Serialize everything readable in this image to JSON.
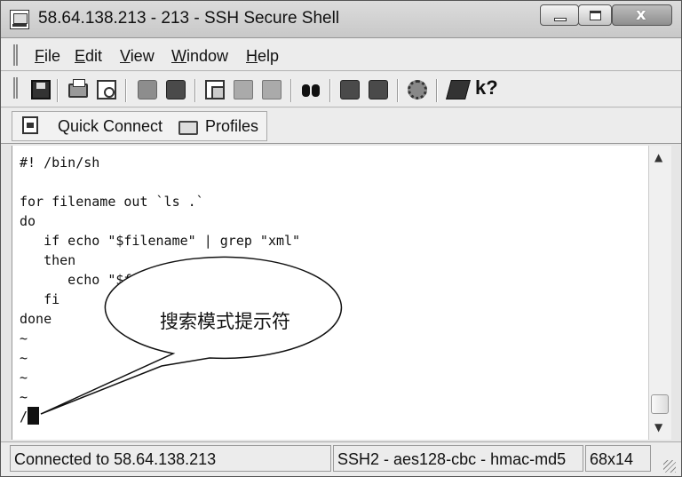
{
  "window": {
    "title": "58.64.138.213 - 213 - SSH Secure Shell",
    "close_glyph": "x"
  },
  "menu": {
    "items": [
      "File",
      "Edit",
      "View",
      "Window",
      "Help"
    ]
  },
  "toolbar": {
    "help_glyph": "k?"
  },
  "quickbar": {
    "quick_connect": "Quick Connect",
    "profiles": "Profiles"
  },
  "terminal": {
    "lines": [
      "#! /bin/sh",
      "",
      "for filename out `ls .`",
      "do",
      "   if echo \"$filename\" | grep \"xml\"",
      "   then",
      "      echo \"$fil",
      "   fi",
      "done",
      "~",
      "~",
      "~",
      "~",
      "/"
    ]
  },
  "callout": {
    "text": "搜索模式提示符"
  },
  "status": {
    "connection": "Connected to 58.64.138.213",
    "cipher": "SSH2 - aes128-cbc - hmac-md5",
    "size": "68x14"
  }
}
